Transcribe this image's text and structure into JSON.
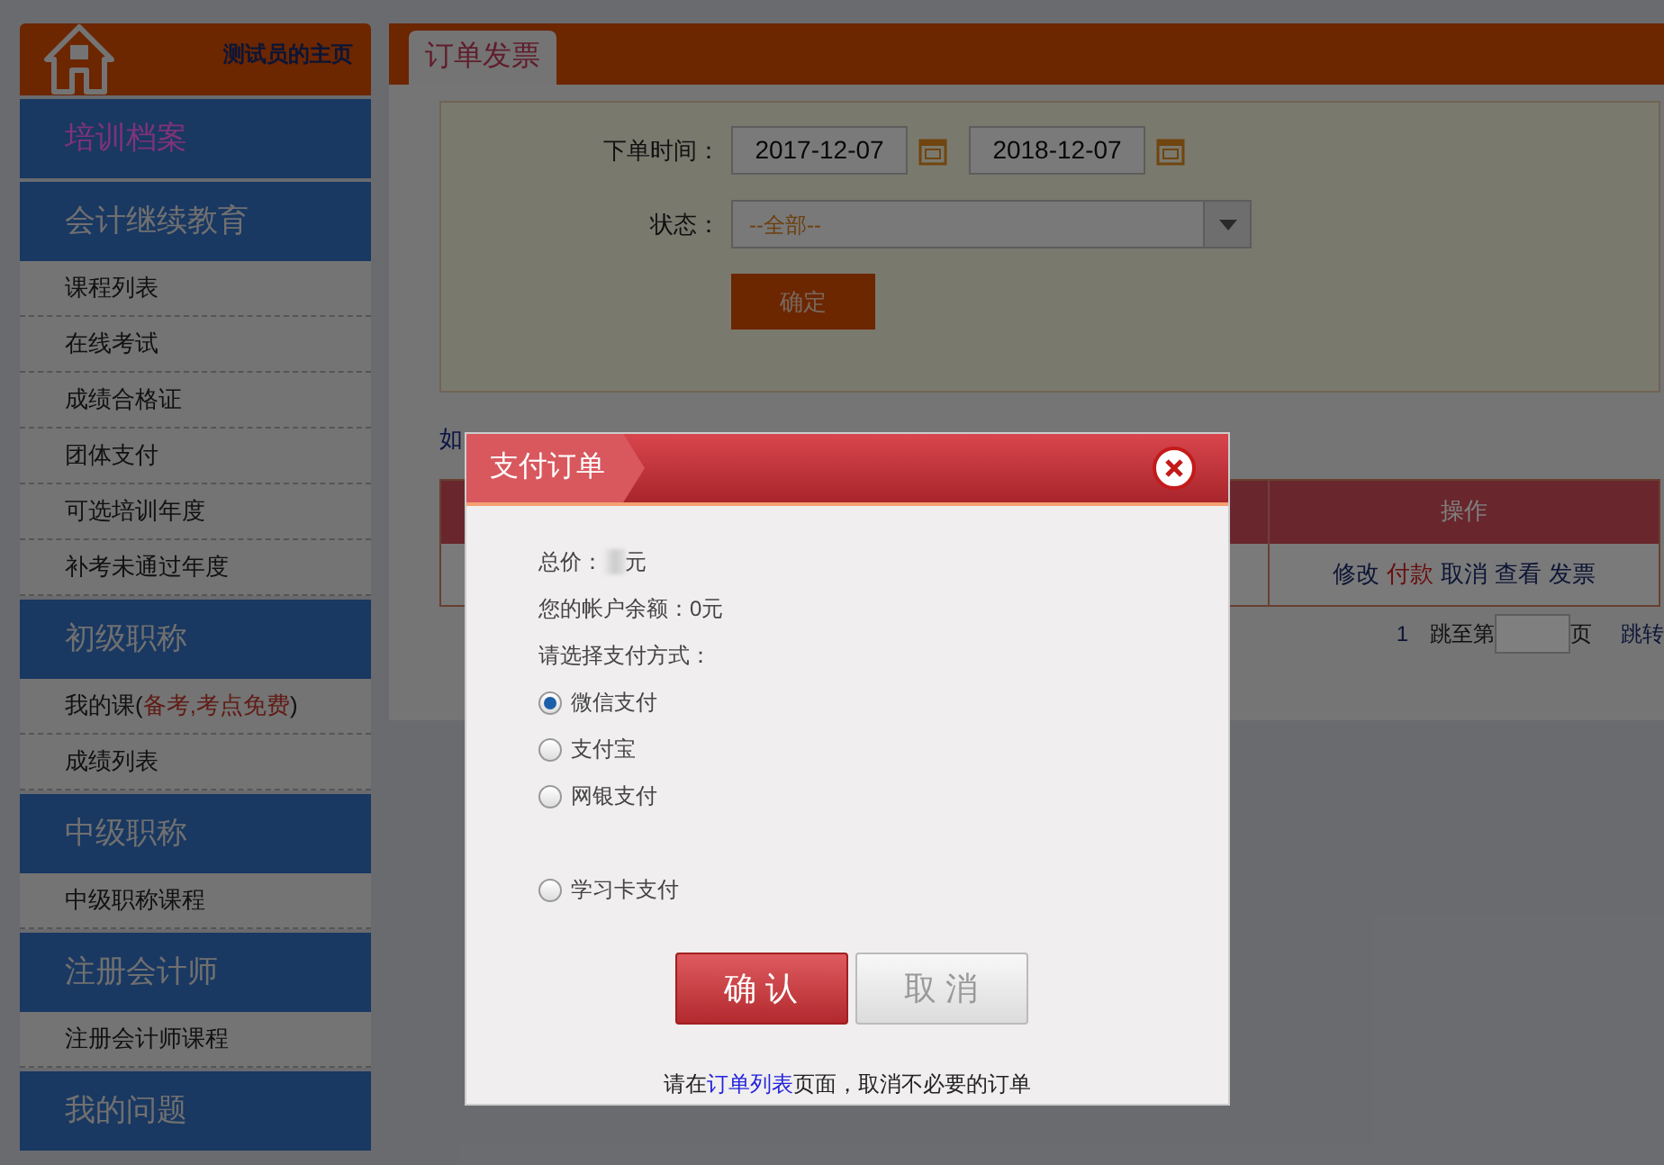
{
  "sidebar": {
    "home_label": "测试员的主页",
    "sections": [
      {
        "title": "培训档案",
        "selected": true
      },
      {
        "title": "会计继续教育",
        "selected": false,
        "items": [
          {
            "label": "课程列表"
          },
          {
            "label": "在线考试"
          },
          {
            "label": "成绩合格证"
          },
          {
            "label": "团体支付"
          },
          {
            "label": "可选培训年度"
          },
          {
            "label": "补考未通过年度"
          }
        ]
      },
      {
        "title": "初级职称",
        "selected": false,
        "items": [
          {
            "label": "我的课(",
            "note": "备考,考点免费",
            "label_end": ")"
          },
          {
            "label": "成绩列表"
          }
        ]
      },
      {
        "title": "中级职称",
        "selected": false,
        "items": [
          {
            "label": "中级职称课程"
          }
        ]
      },
      {
        "title": "注册会计师",
        "selected": false,
        "items": [
          {
            "label": "注册会计师课程"
          }
        ]
      },
      {
        "title": "我的问题",
        "selected": false
      }
    ]
  },
  "main": {
    "tab": "订单发票",
    "filter": {
      "date_label": "下单时间：",
      "date_from": "2017-12-07",
      "date_to": "2018-12-07",
      "status_label": "状态：",
      "status_value": "--全部--",
      "submit": "确定"
    },
    "help_link": "如",
    "table": {
      "columns": [
        "操作"
      ],
      "row_actions": [
        {
          "label": "修改",
          "kind": "link"
        },
        {
          "label": "付款",
          "kind": "alert"
        },
        {
          "label": "取消",
          "kind": "link"
        },
        {
          "label": "查看",
          "kind": "link"
        },
        {
          "label": "发票",
          "kind": "link"
        }
      ]
    },
    "pagination": {
      "page": "1",
      "goto_label": "跳至第",
      "page_suffix": "页",
      "go": "跳转"
    }
  },
  "dialog": {
    "title": "支付订单",
    "price_label": "总价：",
    "price_unit": "元",
    "balance": "您的帐户余额：0元",
    "method_prompt": "请选择支付方式：",
    "methods": [
      {
        "label": "微信支付",
        "selected": true
      },
      {
        "label": "支付宝",
        "selected": false
      },
      {
        "label": "网银支付",
        "selected": false
      }
    ],
    "card_methods": [
      {
        "label": "学习卡支付",
        "selected": false
      }
    ],
    "confirm": "确 认",
    "cancel": "取 消",
    "note_before": "请在",
    "note_link": "订单列表",
    "note_after": "页面，取消不必要的订单"
  }
}
